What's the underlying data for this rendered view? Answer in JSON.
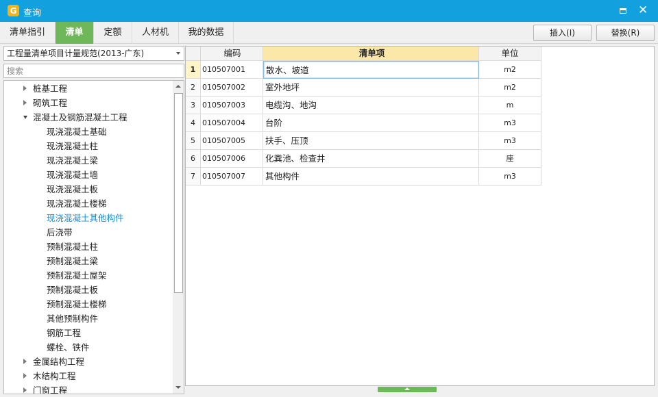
{
  "window": {
    "title": "查询",
    "icon_letter": "G"
  },
  "tabs": [
    {
      "label": "清单指引",
      "active": false
    },
    {
      "label": "清单",
      "active": true
    },
    {
      "label": "定额",
      "active": false
    },
    {
      "label": "人材机",
      "active": false
    },
    {
      "label": "我的数据",
      "active": false
    }
  ],
  "actions": {
    "insert_label": "插入(I)",
    "replace_label": "替换(R)"
  },
  "left": {
    "spec_selected": "工程量清单项目计量规范(2013-广东)",
    "search_placeholder": "搜索",
    "tree": [
      {
        "label": "桩基工程",
        "state": "collapsed"
      },
      {
        "label": "砌筑工程",
        "state": "collapsed"
      },
      {
        "label": "混凝土及钢筋混凝土工程",
        "state": "expanded"
      },
      {
        "label": "现浇混凝土基础",
        "state": "leaf"
      },
      {
        "label": "现浇混凝土柱",
        "state": "leaf"
      },
      {
        "label": "现浇混凝土梁",
        "state": "leaf"
      },
      {
        "label": "现浇混凝土墙",
        "state": "leaf"
      },
      {
        "label": "现浇混凝土板",
        "state": "leaf"
      },
      {
        "label": "现浇混凝土楼梯",
        "state": "leaf"
      },
      {
        "label": "现浇混凝土其他构件",
        "state": "leaf",
        "selected": true
      },
      {
        "label": "后浇带",
        "state": "leaf"
      },
      {
        "label": "预制混凝土柱",
        "state": "leaf"
      },
      {
        "label": "预制混凝土梁",
        "state": "leaf"
      },
      {
        "label": "预制混凝土屋架",
        "state": "leaf"
      },
      {
        "label": "预制混凝土板",
        "state": "leaf"
      },
      {
        "label": "预制混凝土楼梯",
        "state": "leaf"
      },
      {
        "label": "其他预制构件",
        "state": "leaf"
      },
      {
        "label": "钢筋工程",
        "state": "leaf"
      },
      {
        "label": "螺栓、铁件",
        "state": "leaf"
      },
      {
        "label": "金属结构工程",
        "state": "collapsed"
      },
      {
        "label": "木结构工程",
        "state": "collapsed"
      },
      {
        "label": "门窗工程",
        "state": "collapsed"
      }
    ]
  },
  "table": {
    "headers": {
      "code": "编码",
      "name": "清单项",
      "unit": "单位"
    },
    "rows": [
      {
        "index": "1",
        "code": "010507001",
        "name": "散水、坡道",
        "unit": "m2"
      },
      {
        "index": "2",
        "code": "010507002",
        "name": "室外地坪",
        "unit": "m2"
      },
      {
        "index": "3",
        "code": "010507003",
        "name": "电缆沟、地沟",
        "unit": "m"
      },
      {
        "index": "4",
        "code": "010507004",
        "name": "台阶",
        "unit": "m3"
      },
      {
        "index": "5",
        "code": "010507005",
        "name": "扶手、压顶",
        "unit": "m3"
      },
      {
        "index": "6",
        "code": "010507006",
        "name": "化粪池、检查井",
        "unit": "座"
      },
      {
        "index": "7",
        "code": "010507007",
        "name": "其他构件",
        "unit": "m3"
      }
    ]
  },
  "colors": {
    "titlebar": "#12a0df",
    "active_tab": "#6fb85a",
    "header_highlight": "#fbe7a8",
    "selected_tree_text": "#1b8fd2"
  }
}
